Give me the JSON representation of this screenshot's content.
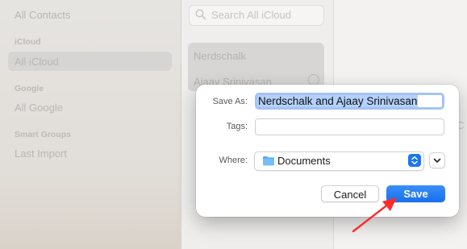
{
  "sidebar": {
    "all_contacts": "All Contacts",
    "icloud_header": "iCloud",
    "all_icloud": "All iCloud",
    "google_header": "Google",
    "all_google": "All Google",
    "smart_groups_header": "Smart Groups",
    "last_import": "Last Import"
  },
  "list": {
    "search_placeholder": "Search All iCloud",
    "contact_1": "Nerdschalk",
    "contact_2": "Ajaay Srinivasan"
  },
  "detail": {
    "partial_text": "C"
  },
  "dialog": {
    "save_as_label": "Save As:",
    "save_as_value": "Nerdschalk and Ajaay Srinivasan",
    "tags_label": "Tags:",
    "tags_value": "",
    "where_label": "Where:",
    "where_value": "Documents",
    "cancel_label": "Cancel",
    "save_label": "Save"
  },
  "colors": {
    "accent": "#1670ec",
    "annotation_arrow": "#ff2a2a",
    "folder": "#5aaef0"
  },
  "icons": [
    "search-icon",
    "folder-icon",
    "updown-chevron-icon",
    "chevron-down-icon",
    "info-icon",
    "arrow-annotation"
  ]
}
